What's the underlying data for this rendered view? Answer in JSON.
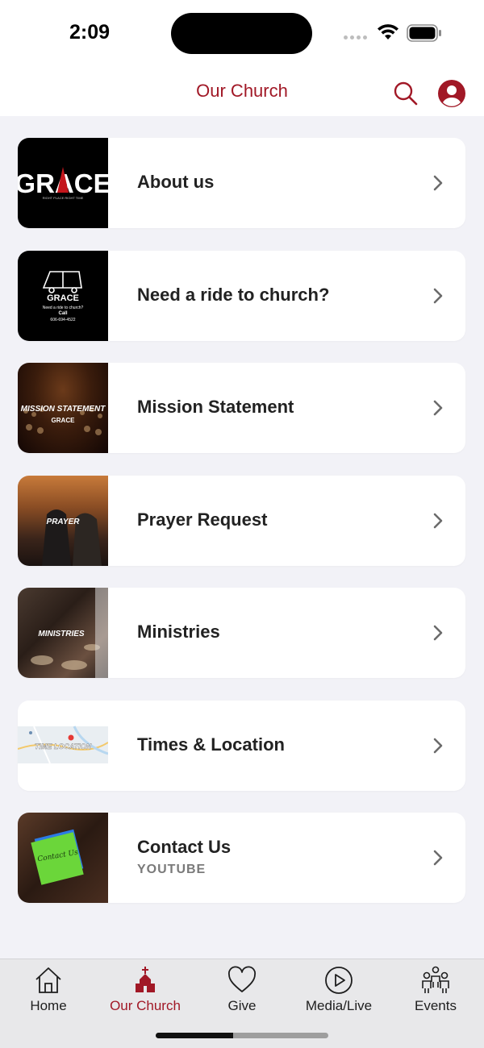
{
  "status_bar": {
    "time": "2:09"
  },
  "header": {
    "title": "Our Church"
  },
  "menu": {
    "items": [
      {
        "label": "About us",
        "thumb_text": "GRACE",
        "thumb_small": "RIGHT PLACE RIGHT TIME"
      },
      {
        "label": "Need a ride to church?",
        "thumb_text": "GRACE",
        "thumb_line1": "Need a ride to church?",
        "thumb_line2": "Call",
        "thumb_line3": "606-694-4522"
      },
      {
        "label": "Mission Statement",
        "thumb_text": "MISSION STATEMENT",
        "thumb_brand": "GRACE"
      },
      {
        "label": "Prayer Request",
        "thumb_text": "PRAYER"
      },
      {
        "label": "Ministries",
        "thumb_text": "MINISTRIES"
      },
      {
        "label": "Times & Location",
        "thumb_text": "TIME LOCATION"
      },
      {
        "label": "Contact Us",
        "subtitle": "YOUTUBE",
        "thumb_text": "Contact Us"
      }
    ]
  },
  "tab_bar": {
    "tabs": [
      {
        "label": "Home",
        "icon": "house-icon"
      },
      {
        "label": "Our Church",
        "icon": "church-icon"
      },
      {
        "label": "Give",
        "icon": "heart-icon"
      },
      {
        "label": "Media/Live",
        "icon": "play-circle-icon"
      },
      {
        "label": "Events",
        "icon": "people-icon"
      }
    ],
    "active": "Our Church"
  },
  "colors": {
    "accent": "#a11826",
    "background": "#f2f2f7",
    "card": "#ffffff"
  }
}
